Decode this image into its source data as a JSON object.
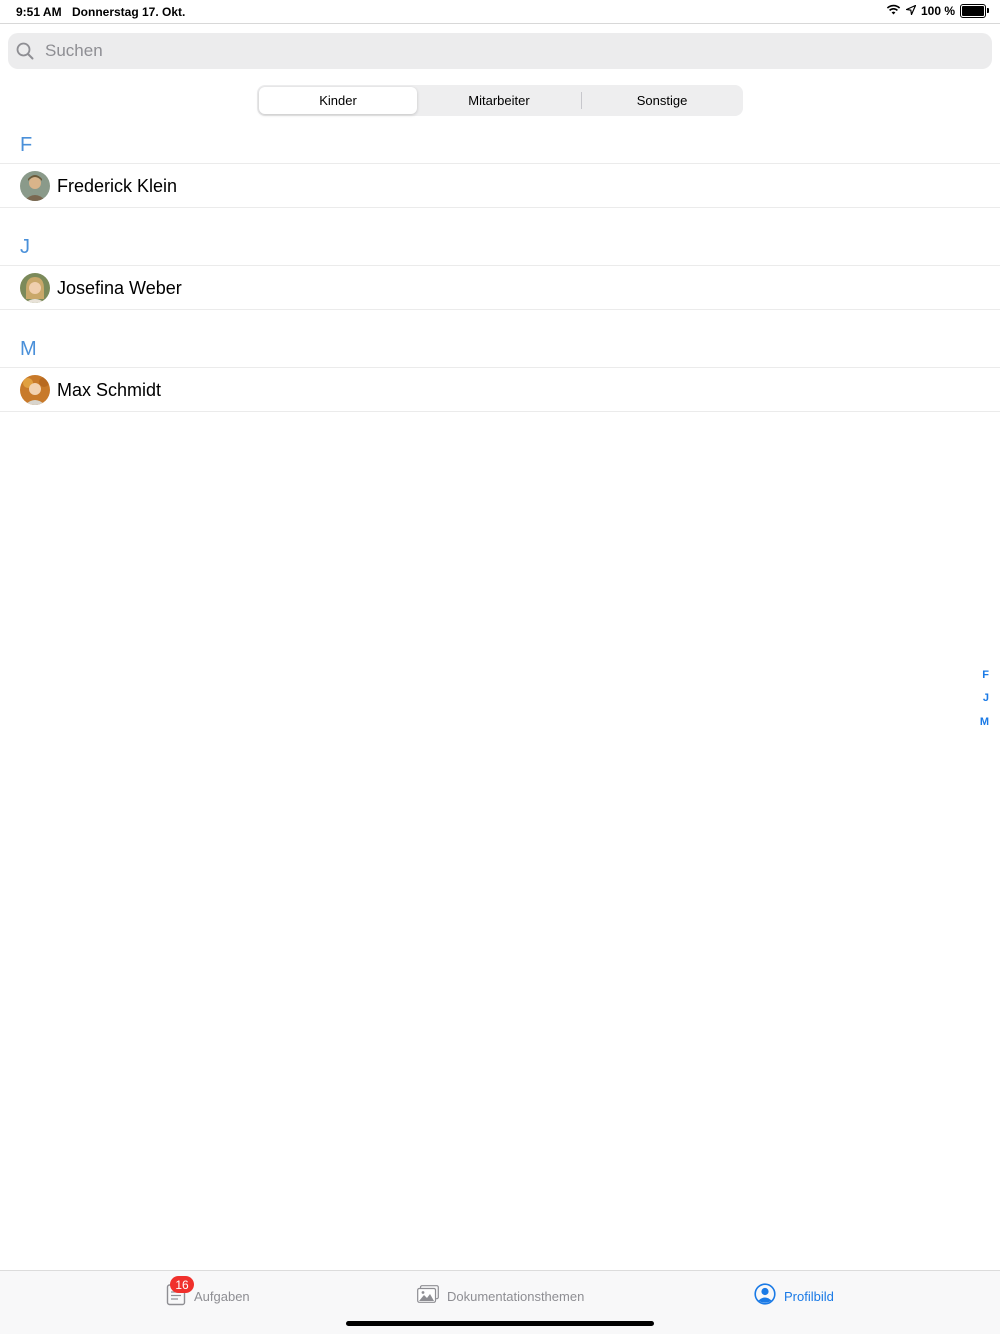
{
  "status_bar": {
    "time": "9:51 AM",
    "date": "Donnerstag 17. Okt.",
    "battery_label": "100 %",
    "battery_level": 1.0
  },
  "search": {
    "placeholder": "Suchen"
  },
  "segmented_control": {
    "segments": [
      "Kinder",
      "Mitarbeiter",
      "Sonstige"
    ],
    "selected": "Kinder"
  },
  "sections": [
    {
      "letter": "F",
      "contacts": [
        {
          "name": "Frederick Klein"
        }
      ]
    },
    {
      "letter": "J",
      "contacts": [
        {
          "name": "Josefina Weber"
        }
      ]
    },
    {
      "letter": "M",
      "contacts": [
        {
          "name": "Max Schmidt"
        }
      ]
    }
  ],
  "section_index": [
    "F",
    "J",
    "M"
  ],
  "tab_bar": {
    "items": [
      {
        "label": "Aufgaben",
        "icon": "document-list-icon",
        "badge": "16"
      },
      {
        "label": "Dokumentationsthemen",
        "icon": "photos-icon"
      },
      {
        "label": "Profilbild",
        "icon": "profile-icon",
        "active": true
      }
    ]
  },
  "colors": {
    "accent": "#1a7ae6",
    "section_header": "#4a90d9",
    "badge": "#f0302c"
  }
}
